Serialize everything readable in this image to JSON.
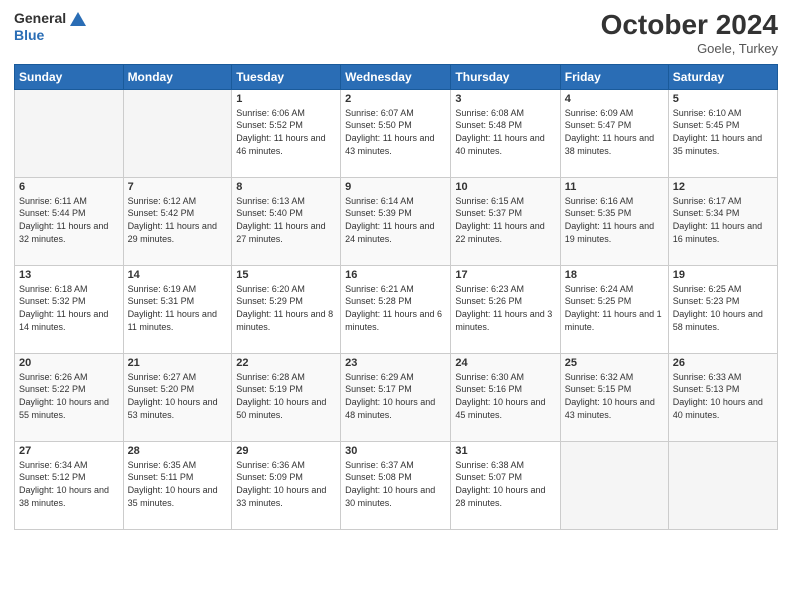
{
  "header": {
    "logo_general": "General",
    "logo_blue": "Blue",
    "month": "October 2024",
    "location": "Goele, Turkey"
  },
  "weekdays": [
    "Sunday",
    "Monday",
    "Tuesday",
    "Wednesday",
    "Thursday",
    "Friday",
    "Saturday"
  ],
  "weeks": [
    [
      {
        "day": "",
        "info": ""
      },
      {
        "day": "",
        "info": ""
      },
      {
        "day": "1",
        "info": "Sunrise: 6:06 AM\nSunset: 5:52 PM\nDaylight: 11 hours and 46 minutes."
      },
      {
        "day": "2",
        "info": "Sunrise: 6:07 AM\nSunset: 5:50 PM\nDaylight: 11 hours and 43 minutes."
      },
      {
        "day": "3",
        "info": "Sunrise: 6:08 AM\nSunset: 5:48 PM\nDaylight: 11 hours and 40 minutes."
      },
      {
        "day": "4",
        "info": "Sunrise: 6:09 AM\nSunset: 5:47 PM\nDaylight: 11 hours and 38 minutes."
      },
      {
        "day": "5",
        "info": "Sunrise: 6:10 AM\nSunset: 5:45 PM\nDaylight: 11 hours and 35 minutes."
      }
    ],
    [
      {
        "day": "6",
        "info": "Sunrise: 6:11 AM\nSunset: 5:44 PM\nDaylight: 11 hours and 32 minutes."
      },
      {
        "day": "7",
        "info": "Sunrise: 6:12 AM\nSunset: 5:42 PM\nDaylight: 11 hours and 29 minutes."
      },
      {
        "day": "8",
        "info": "Sunrise: 6:13 AM\nSunset: 5:40 PM\nDaylight: 11 hours and 27 minutes."
      },
      {
        "day": "9",
        "info": "Sunrise: 6:14 AM\nSunset: 5:39 PM\nDaylight: 11 hours and 24 minutes."
      },
      {
        "day": "10",
        "info": "Sunrise: 6:15 AM\nSunset: 5:37 PM\nDaylight: 11 hours and 22 minutes."
      },
      {
        "day": "11",
        "info": "Sunrise: 6:16 AM\nSunset: 5:35 PM\nDaylight: 11 hours and 19 minutes."
      },
      {
        "day": "12",
        "info": "Sunrise: 6:17 AM\nSunset: 5:34 PM\nDaylight: 11 hours and 16 minutes."
      }
    ],
    [
      {
        "day": "13",
        "info": "Sunrise: 6:18 AM\nSunset: 5:32 PM\nDaylight: 11 hours and 14 minutes."
      },
      {
        "day": "14",
        "info": "Sunrise: 6:19 AM\nSunset: 5:31 PM\nDaylight: 11 hours and 11 minutes."
      },
      {
        "day": "15",
        "info": "Sunrise: 6:20 AM\nSunset: 5:29 PM\nDaylight: 11 hours and 8 minutes."
      },
      {
        "day": "16",
        "info": "Sunrise: 6:21 AM\nSunset: 5:28 PM\nDaylight: 11 hours and 6 minutes."
      },
      {
        "day": "17",
        "info": "Sunrise: 6:23 AM\nSunset: 5:26 PM\nDaylight: 11 hours and 3 minutes."
      },
      {
        "day": "18",
        "info": "Sunrise: 6:24 AM\nSunset: 5:25 PM\nDaylight: 11 hours and 1 minute."
      },
      {
        "day": "19",
        "info": "Sunrise: 6:25 AM\nSunset: 5:23 PM\nDaylight: 10 hours and 58 minutes."
      }
    ],
    [
      {
        "day": "20",
        "info": "Sunrise: 6:26 AM\nSunset: 5:22 PM\nDaylight: 10 hours and 55 minutes."
      },
      {
        "day": "21",
        "info": "Sunrise: 6:27 AM\nSunset: 5:20 PM\nDaylight: 10 hours and 53 minutes."
      },
      {
        "day": "22",
        "info": "Sunrise: 6:28 AM\nSunset: 5:19 PM\nDaylight: 10 hours and 50 minutes."
      },
      {
        "day": "23",
        "info": "Sunrise: 6:29 AM\nSunset: 5:17 PM\nDaylight: 10 hours and 48 minutes."
      },
      {
        "day": "24",
        "info": "Sunrise: 6:30 AM\nSunset: 5:16 PM\nDaylight: 10 hours and 45 minutes."
      },
      {
        "day": "25",
        "info": "Sunrise: 6:32 AM\nSunset: 5:15 PM\nDaylight: 10 hours and 43 minutes."
      },
      {
        "day": "26",
        "info": "Sunrise: 6:33 AM\nSunset: 5:13 PM\nDaylight: 10 hours and 40 minutes."
      }
    ],
    [
      {
        "day": "27",
        "info": "Sunrise: 6:34 AM\nSunset: 5:12 PM\nDaylight: 10 hours and 38 minutes."
      },
      {
        "day": "28",
        "info": "Sunrise: 6:35 AM\nSunset: 5:11 PM\nDaylight: 10 hours and 35 minutes."
      },
      {
        "day": "29",
        "info": "Sunrise: 6:36 AM\nSunset: 5:09 PM\nDaylight: 10 hours and 33 minutes."
      },
      {
        "day": "30",
        "info": "Sunrise: 6:37 AM\nSunset: 5:08 PM\nDaylight: 10 hours and 30 minutes."
      },
      {
        "day": "31",
        "info": "Sunrise: 6:38 AM\nSunset: 5:07 PM\nDaylight: 10 hours and 28 minutes."
      },
      {
        "day": "",
        "info": ""
      },
      {
        "day": "",
        "info": ""
      }
    ]
  ]
}
